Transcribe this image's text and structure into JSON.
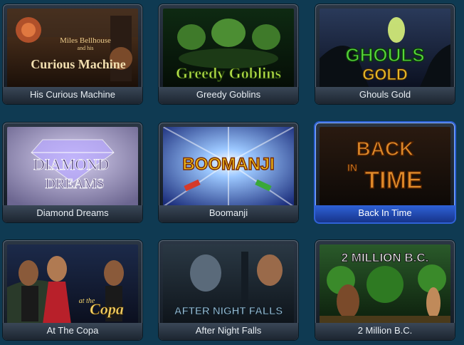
{
  "games": [
    {
      "title": "His Curious Machine",
      "logo_lines": [
        "Miles Bellhouse",
        "and his",
        "Curious Machine"
      ]
    },
    {
      "title": "Greedy Goblins",
      "logo_lines": [
        "Greedy Goblins"
      ]
    },
    {
      "title": "Ghouls Gold",
      "logo_lines": [
        "GHOULS",
        "GOLD"
      ]
    },
    {
      "title": "Diamond Dreams",
      "logo_lines": [
        "DIAMOND",
        "DREAMS"
      ]
    },
    {
      "title": "Boomanji",
      "logo_lines": [
        "BOOMANJI"
      ]
    },
    {
      "title": "Back In Time",
      "logo_lines": [
        "BACK",
        "IN",
        "TIME"
      ]
    },
    {
      "title": "At The Copa",
      "logo_lines": [
        "at the",
        "Copa"
      ]
    },
    {
      "title": "After Night Falls",
      "logo_lines": [
        "AFTER NIGHT FALLS"
      ]
    },
    {
      "title": "2 Million B.C.",
      "logo_lines": [
        "2 MILLION B.C."
      ]
    }
  ],
  "selected_index": 5,
  "colors": {
    "page_bg": "#0f3a52",
    "tile_label_bg": "#2b3644",
    "selected_border": "#2f62d8"
  }
}
